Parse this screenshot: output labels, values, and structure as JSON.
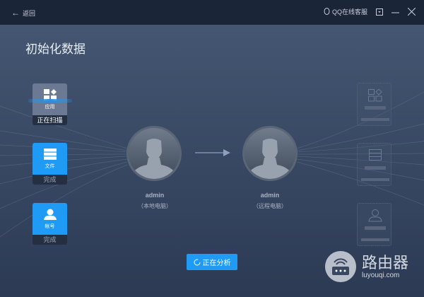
{
  "titlebar": {
    "back_label": "返回",
    "support_label": "QQ在线客服"
  },
  "page_title": "初始化数据",
  "items": [
    {
      "label": "应用",
      "status": "正在扫描"
    },
    {
      "label": "文件",
      "status": "完成"
    },
    {
      "label": "帐号",
      "status": "完成"
    }
  ],
  "local": {
    "name": "admin",
    "role": "（本地电脑）"
  },
  "remote": {
    "name": "admin",
    "role": "（远程电脑）"
  },
  "analyze_button": "正在分析",
  "watermark": {
    "title": "路由器",
    "url": "luyouqi.com"
  },
  "colors": {
    "accent": "#1f9bf6",
    "titlebar": "#1b2538"
  }
}
